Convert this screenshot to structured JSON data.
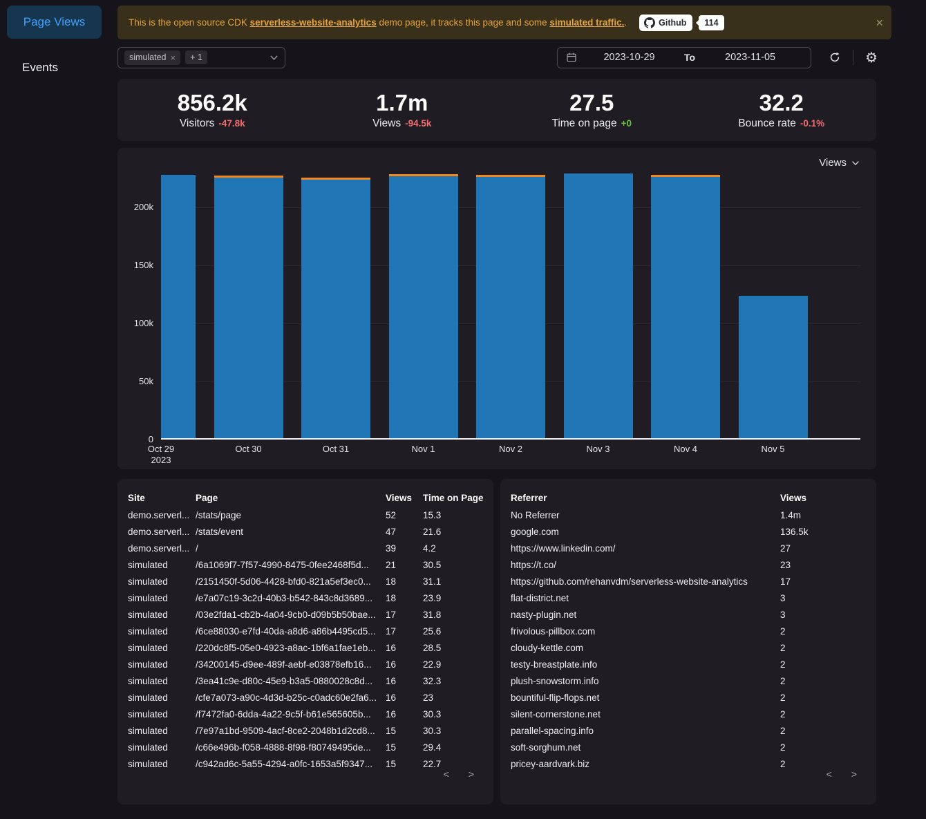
{
  "sidebar": {
    "items": [
      {
        "label": "Page Views",
        "active": true
      },
      {
        "label": "Events",
        "active": false
      }
    ]
  },
  "banner": {
    "text_before": "This is the open source CDK ",
    "link1": "serverless-website-analytics",
    "text_mid": " demo page, it tracks this page and some ",
    "link2": "simulated traffic.",
    "text_after": ".",
    "github_label": "Github",
    "github_count": "114",
    "close_glyph": "×"
  },
  "filterbar": {
    "tag": "simulated",
    "tag_close_glyph": "×",
    "more_tag": "+ 1",
    "date_from": "2023-10-29",
    "date_separator": "To",
    "date_to": "2023-11-05",
    "gear_glyph": "⚙"
  },
  "stats": [
    {
      "value": "856.2k",
      "label": "Visitors",
      "delta": "-47.8k",
      "delta_color": "#f56c6c"
    },
    {
      "value": "1.7m",
      "label": "Views",
      "delta": "-94.5k",
      "delta_color": "#f56c6c"
    },
    {
      "value": "27.5",
      "label": "Time on page",
      "delta": "+0",
      "delta_color": "#67c23a"
    },
    {
      "value": "32.2",
      "label": "Bounce rate",
      "delta": "-0.1%",
      "delta_color": "#f56c6c"
    }
  ],
  "chart": {
    "selector_label": "Views"
  },
  "chart_data": {
    "type": "bar",
    "title": "",
    "xlabel": "",
    "ylabel": "",
    "categories": [
      "Oct 29",
      "Oct 30",
      "Oct 31",
      "Nov 1",
      "Nov 2",
      "Nov 3",
      "Nov 4",
      "Nov 5"
    ],
    "x_sub_label": "2023",
    "x_sub_label_index": 0,
    "ylim": [
      0,
      229000
    ],
    "yticks": [
      0,
      50000,
      100000,
      150000,
      200000
    ],
    "ytick_labels": [
      "0",
      "50k",
      "100k",
      "150k",
      "200k"
    ],
    "grid": true,
    "legend": "top-right metric selector",
    "bar_color": "#2176b5",
    "overlay_color": "#f0881e",
    "series": [
      {
        "name": "Views",
        "values": [
          226500,
          226000,
          224500,
          227300,
          226500,
          228200,
          226700,
          122300
        ]
      },
      {
        "name": "overlay-line",
        "values": [
          null,
          226300,
          224800,
          227600,
          226900,
          null,
          227100,
          null
        ]
      }
    ]
  },
  "pages_table": {
    "headers": [
      "Site",
      "Page",
      "Views",
      "Time on Page"
    ],
    "rows": [
      [
        "demo.serverl...",
        "/stats/page",
        "52",
        "15.3"
      ],
      [
        "demo.serverl...",
        "/stats/event",
        "47",
        "21.6"
      ],
      [
        "demo.serverl...",
        "/",
        "39",
        "4.2"
      ],
      [
        "simulated",
        "/6a1069f7-7f57-4990-8475-0fee2468f5d...",
        "21",
        "30.5"
      ],
      [
        "simulated",
        "/2151450f-5d06-4428-bfd0-821a5ef3ec0...",
        "18",
        "31.1"
      ],
      [
        "simulated",
        "/e7a07c19-3c2d-40b3-b542-843c8d3689...",
        "18",
        "23.9"
      ],
      [
        "simulated",
        "/03e2fda1-cb2b-4a04-9cb0-d09b5b50bae...",
        "17",
        "31.8"
      ],
      [
        "simulated",
        "/6ce88030-e7fd-40da-a8d6-a86b4495cd5...",
        "17",
        "25.6"
      ],
      [
        "simulated",
        "/220dc8f5-05e0-4923-a8ac-1bf6a1fae1eb...",
        "16",
        "28.5"
      ],
      [
        "simulated",
        "/34200145-d9ee-489f-aebf-e03878efb16...",
        "16",
        "22.9"
      ],
      [
        "simulated",
        "/3ea41c9e-d80c-45e9-b3a5-0880028c8d...",
        "16",
        "32.3"
      ],
      [
        "simulated",
        "/cfe7a073-a90c-4d3d-b25c-c0adc60e2fa6...",
        "16",
        "23"
      ],
      [
        "simulated",
        "/f7472fa0-6dda-4a22-9c5f-b61e565605b...",
        "16",
        "30.3"
      ],
      [
        "simulated",
        "/7e97a1bd-9509-4acf-8ce2-2048b1d2cd8...",
        "15",
        "30.3"
      ],
      [
        "simulated",
        "/c66e496b-f058-4888-8f98-f80749495de...",
        "15",
        "29.4"
      ],
      [
        "simulated",
        "/c942ad6c-5a55-4294-a0fc-1653a5f9347...",
        "15",
        "22.7"
      ]
    ]
  },
  "referrers_table": {
    "headers": [
      "Referrer",
      "Views"
    ],
    "rows": [
      [
        "No Referrer",
        "1.4m"
      ],
      [
        "google.com",
        "136.5k"
      ],
      [
        "https://www.linkedin.com/",
        "27"
      ],
      [
        "https://t.co/",
        "23"
      ],
      [
        "https://github.com/rehanvdm/serverless-website-analytics",
        "17"
      ],
      [
        "flat-district.net",
        "3"
      ],
      [
        "nasty-plugin.net",
        "3"
      ],
      [
        "frivolous-pillbox.com",
        "2"
      ],
      [
        "cloudy-kettle.com",
        "2"
      ],
      [
        "testy-breastplate.info",
        "2"
      ],
      [
        "plush-snowstorm.info",
        "2"
      ],
      [
        "bountiful-flip-flops.net",
        "2"
      ],
      [
        "silent-cornerstone.net",
        "2"
      ],
      [
        "parallel-spacing.info",
        "2"
      ],
      [
        "soft-sorghum.net",
        "2"
      ],
      [
        "pricey-aardvark.biz",
        "2"
      ]
    ]
  },
  "pagination": {
    "prev": "<",
    "next": ">"
  }
}
